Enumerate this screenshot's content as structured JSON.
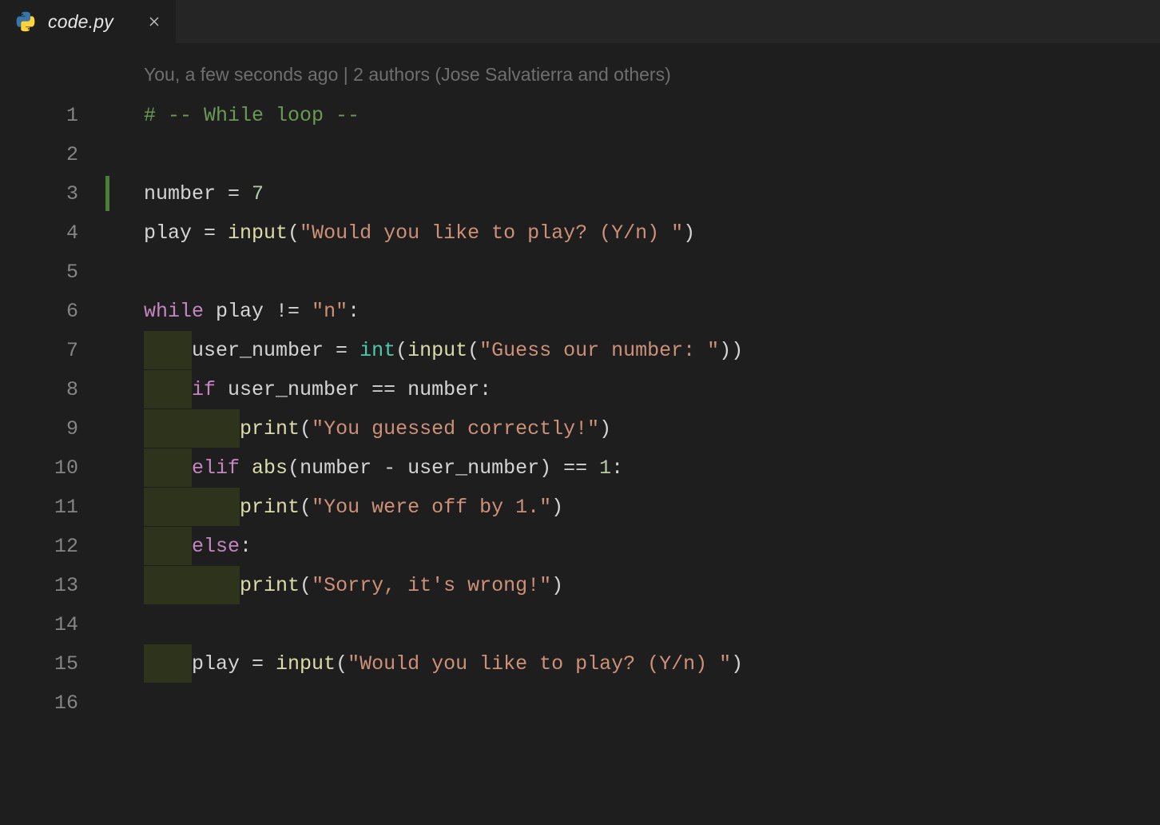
{
  "tab": {
    "filename": "code.py",
    "language_icon": "python-icon"
  },
  "codelens": {
    "text": "You, a few seconds ago | 2 authors (Jose Salvatierra and others)"
  },
  "gutter": {
    "line_numbers": [
      "1",
      "2",
      "3",
      "4",
      "5",
      "6",
      "7",
      "8",
      "9",
      "10",
      "11",
      "12",
      "13",
      "14",
      "15",
      "16"
    ],
    "modified_line": 3
  },
  "code": {
    "comment_1": "# -- While loop --",
    "l3_var": "number",
    "l3_eq": " = ",
    "l3_val": "7",
    "l4_var": "play",
    "l4_eq": " = ",
    "l4_fn": "input",
    "l4_str": "\"Would you like to play? (Y/n) \"",
    "l6_kw": "while",
    "l6_rest_a": " play ",
    "l6_op": "!=",
    "l6_rest_b": " ",
    "l6_str": "\"n\"",
    "l6_colon": ":",
    "l7_var": "user_number",
    "l7_eq": " = ",
    "l7_type": "int",
    "l7_fn": "input",
    "l7_str": "\"Guess our number: \"",
    "l8_kw": "if",
    "l8_body": " user_number == number:",
    "l9_fn": "print",
    "l9_str": "\"You guessed correctly!\"",
    "l10_kw": "elif",
    "l10_pre": " ",
    "l10_fn": "abs",
    "l10_args": "(number - user_number)",
    "l10_post": " == ",
    "l10_num": "1",
    "l10_colon": ":",
    "l11_fn": "print",
    "l11_str": "\"You were off by 1.\"",
    "l12_kw": "else",
    "l12_colon": ":",
    "l13_fn": "print",
    "l13_str": "\"Sorry, it's wrong!\"",
    "l15_var": "play",
    "l15_eq": " = ",
    "l15_fn": "input",
    "l15_str": "\"Would you like to play? (Y/n) \""
  }
}
